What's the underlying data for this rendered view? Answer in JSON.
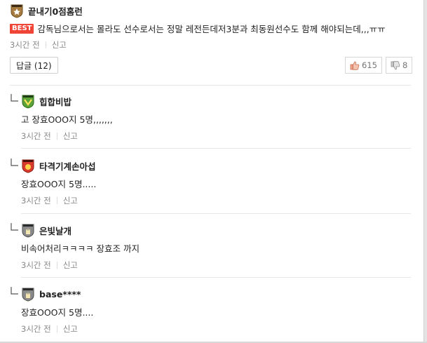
{
  "top_comment": {
    "nickname": "끝내기0점홈런",
    "best_label": "BEST",
    "text": "감독님으로서는 몰라도 선수로서는 정말 레전든데저3분과 최동원선수도 함께 해야되는데,,,ㅠㅠ",
    "time": "3시간 전",
    "report": "신고"
  },
  "reply_button": {
    "label": "답글 (12)"
  },
  "votes": {
    "up": "615",
    "down": "8"
  },
  "replies": [
    {
      "nickname": "힙합비밥",
      "text": "고 장효OOO지 5명,,,,,,,",
      "time": "3시간 전",
      "report": "신고",
      "badge_color": "#5aa339"
    },
    {
      "nickname": "타격기계손아섭",
      "text": "장효OOO지 5명.....",
      "time": "3시간 전",
      "report": "신고",
      "badge_color": "#d93a2b"
    },
    {
      "nickname": "은빛날개",
      "text": "비속어처리ㅋㅋㅋㅋ 장효조 까지",
      "time": "3시간 전",
      "report": "신고",
      "badge_color": "#8a8a8a"
    },
    {
      "nickname": "base****",
      "text": "장효OOO지 5명....",
      "time": "3시간 전",
      "report": "신고",
      "badge_color": "#8a8a8a"
    }
  ],
  "colors": {
    "best_bg": "#ef4436",
    "meta_text": "#888888"
  }
}
